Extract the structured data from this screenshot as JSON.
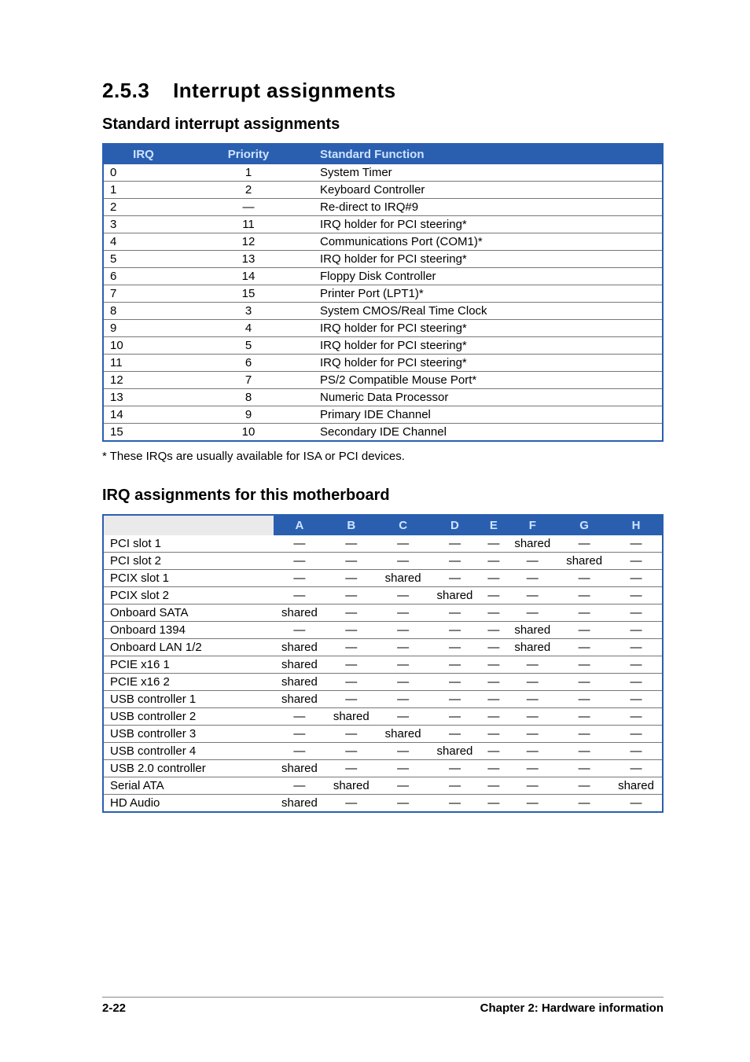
{
  "section_number": "2.5.3",
  "section_title": "Interrupt assignments",
  "sub1_title": "Standard interrupt assignments",
  "table1": {
    "headers": [
      "IRQ",
      "Priority",
      "Standard Function"
    ],
    "rows": [
      [
        "0",
        "1",
        "System Timer"
      ],
      [
        "1",
        "2",
        "Keyboard Controller"
      ],
      [
        "2",
        "—",
        "Re-direct to IRQ#9"
      ],
      [
        "3",
        "11",
        "IRQ holder for PCI steering*"
      ],
      [
        "4",
        "12",
        "Communications Port (COM1)*"
      ],
      [
        "5",
        "13",
        "IRQ holder for PCI steering*"
      ],
      [
        "6",
        "14",
        "Floppy Disk Controller"
      ],
      [
        "7",
        "15",
        "Printer Port (LPT1)*"
      ],
      [
        "8",
        "3",
        "System CMOS/Real Time Clock"
      ],
      [
        "9",
        "4",
        "IRQ holder for PCI steering*"
      ],
      [
        "10",
        "5",
        "IRQ holder for PCI steering*"
      ],
      [
        "11",
        "6",
        "IRQ holder for PCI steering*"
      ],
      [
        "12",
        "7",
        "PS/2 Compatible Mouse Port*"
      ],
      [
        "13",
        "8",
        "Numeric Data Processor"
      ],
      [
        "14",
        "9",
        "Primary IDE Channel"
      ],
      [
        "15",
        "10",
        "Secondary IDE Channel"
      ]
    ]
  },
  "note": "* These IRQs are usually available for ISA or PCI devices.",
  "sub2_title": "IRQ assignments for this motherboard",
  "table2": {
    "headers": [
      "",
      "A",
      "B",
      "C",
      "D",
      "E",
      "F",
      "G",
      "H"
    ],
    "rows": [
      {
        "label": "PCI slot 1",
        "cells": [
          "—",
          "—",
          "—",
          "—",
          "—",
          "shared",
          "—",
          "—"
        ]
      },
      {
        "label": "PCI slot 2",
        "cells": [
          "—",
          "—",
          "—",
          "—",
          "—",
          "—",
          "shared",
          "—"
        ]
      },
      {
        "label": "PCIX slot 1",
        "cells": [
          "—",
          "—",
          "shared",
          "—",
          "—",
          "—",
          "—",
          "—"
        ]
      },
      {
        "label": "PCIX slot 2",
        "cells": [
          "—",
          "—",
          "—",
          "shared",
          "—",
          "—",
          "—",
          "—"
        ]
      },
      {
        "label": "Onboard SATA",
        "cells": [
          "shared",
          "—",
          "—",
          "—",
          "—",
          "—",
          "—",
          "—"
        ]
      },
      {
        "label": "Onboard 1394",
        "cells": [
          "—",
          "—",
          "—",
          "—",
          "—",
          "shared",
          "—",
          "—"
        ]
      },
      {
        "label": "Onboard LAN 1/2",
        "cells": [
          "shared",
          "—",
          "—",
          "—",
          "—",
          "shared",
          "—",
          "—"
        ]
      },
      {
        "label": "PCIE x16 1",
        "cells": [
          "shared",
          "—",
          "—",
          "—",
          "—",
          "—",
          "—",
          "—"
        ]
      },
      {
        "label": "PCIE x16 2",
        "cells": [
          "shared",
          "—",
          "—",
          "—",
          "—",
          "—",
          "—",
          "—"
        ]
      },
      {
        "label": "USB controller 1",
        "cells": [
          "shared",
          "—",
          "—",
          "—",
          "—",
          "—",
          "—",
          "—"
        ]
      },
      {
        "label": "USB controller 2",
        "cells": [
          "—",
          "shared",
          "—",
          "—",
          "—",
          "—",
          "—",
          "—"
        ]
      },
      {
        "label": "USB controller 3",
        "cells": [
          "—",
          "—",
          "shared",
          "—",
          "—",
          "—",
          "—",
          "—"
        ]
      },
      {
        "label": "USB controller 4",
        "cells": [
          "—",
          "—",
          "—",
          "shared",
          "—",
          "—",
          "—",
          "—"
        ]
      },
      {
        "label": "USB 2.0 controller",
        "cells": [
          "shared",
          "—",
          "—",
          "—",
          "—",
          "—",
          "—",
          "—"
        ]
      },
      {
        "label": "Serial ATA",
        "cells": [
          "—",
          "shared",
          "—",
          "—",
          "—",
          "—",
          "—",
          "shared"
        ]
      },
      {
        "label": "HD Audio",
        "cells": [
          "shared",
          "—",
          "—",
          "—",
          "—",
          "—",
          "—",
          "—"
        ]
      }
    ]
  },
  "footer_left": "2-22",
  "footer_right": "Chapter 2: Hardware information"
}
